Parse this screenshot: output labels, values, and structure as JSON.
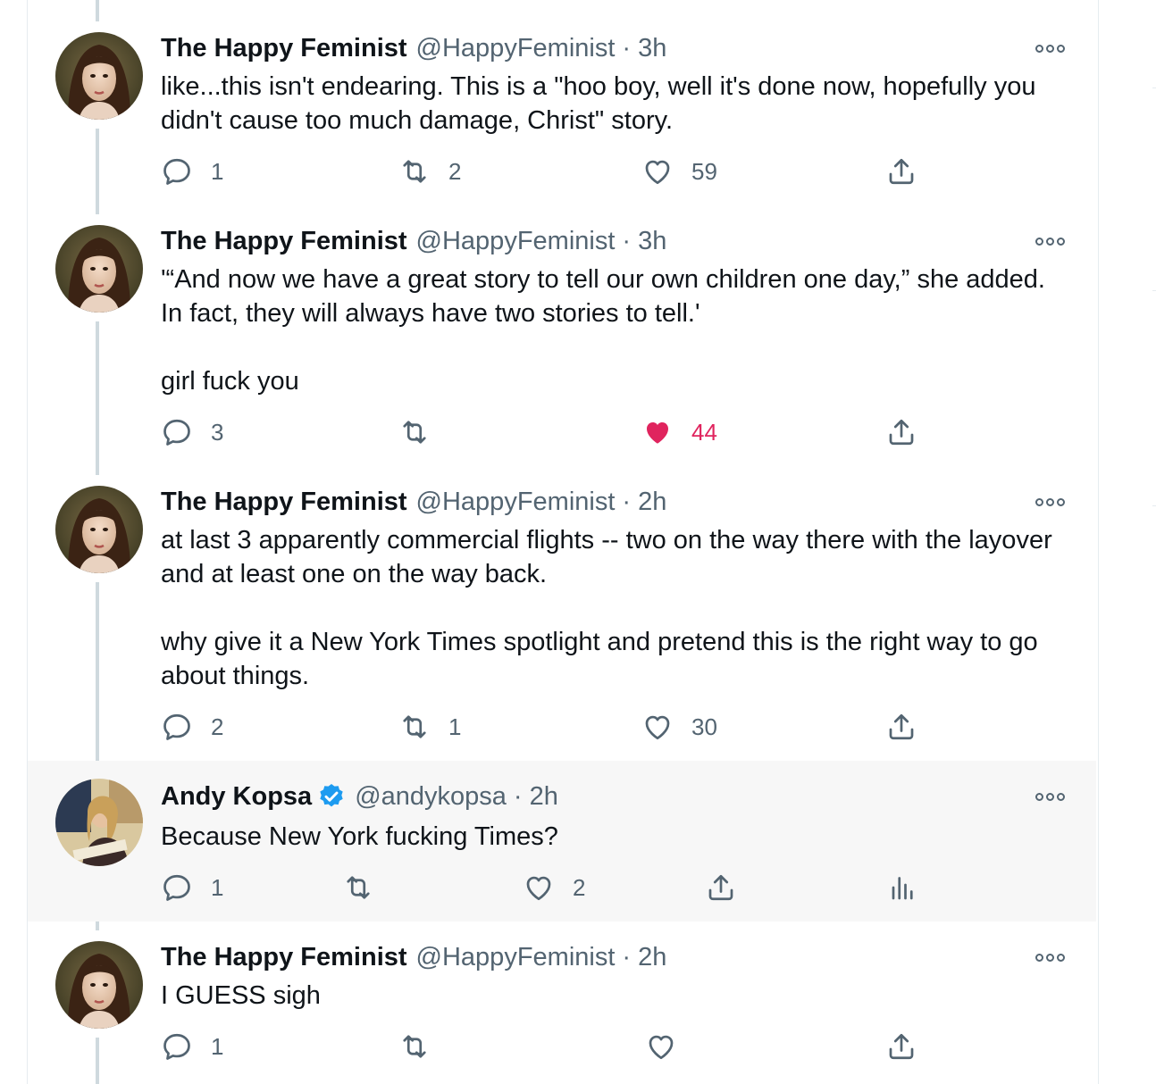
{
  "colors": {
    "like_active": "#e0245e",
    "verified": "#1d9bf0",
    "muted": "#536471"
  },
  "tweets": [
    {
      "name": "The Happy Feminist",
      "handle": "@HappyFeminist",
      "separator": "·",
      "time": "3h",
      "text": "like...this isn't endearing. This is a \"hoo boy, well it's done now, hopefully you didn't cause too much damage, Christ\" story.",
      "replies": "1",
      "retweets": "2",
      "likes": "59",
      "liked": false
    },
    {
      "name": "The Happy Feminist",
      "handle": "@HappyFeminist",
      "separator": "·",
      "time": "3h",
      "text": "'“And now we have a great story to tell our own children one day,” she added. In fact, they will always have two stories to tell.'\n\ngirl fuck you",
      "replies": "3",
      "retweets": "",
      "likes": "44",
      "liked": true
    },
    {
      "name": "The Happy Feminist",
      "handle": "@HappyFeminist",
      "separator": "·",
      "time": "2h",
      "text": "at last 3 apparently commercial flights -- two on the way there with the layover and at least one on the way back.\n\nwhy give it a New York Times spotlight and pretend this is the right way to go about things.",
      "replies": "2",
      "retweets": "1",
      "likes": "30",
      "liked": false
    },
    {
      "name": "Andy Kopsa",
      "handle": "@andykopsa",
      "separator": "·",
      "time": "2h",
      "text": "Because New York fucking Times?",
      "replies": "1",
      "retweets": "",
      "likes": "2",
      "liked": false,
      "verified": true
    },
    {
      "name": "The Happy Feminist",
      "handle": "@HappyFeminist",
      "separator": "·",
      "time": "2h",
      "text": "I GUESS sigh",
      "replies": "1",
      "retweets": "",
      "likes": "",
      "liked": false
    }
  ]
}
